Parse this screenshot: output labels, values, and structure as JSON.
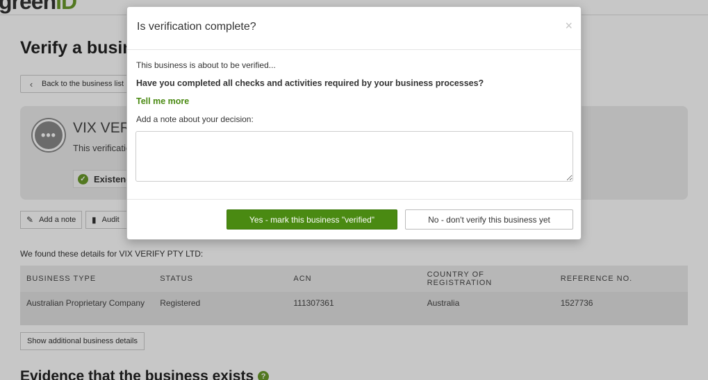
{
  "app": {
    "logo_text": "green",
    "logo_accent": "ID",
    "page_title": "Verify a business",
    "back_button_label": "Back to the business list"
  },
  "status_panel": {
    "icon": "ellipsis-icon",
    "company_name": "VIX VERIFY PTY LTD",
    "subtitle": "This verification is in progress",
    "existence_chip_label": "Existence"
  },
  "actions": {
    "add_note_label": "Add a note",
    "audit_label": "Audit"
  },
  "details": {
    "found_text": "We found these details for VIX VERIFY PTY LTD:",
    "columns": [
      "BUSINESS TYPE",
      "STATUS",
      "ACN",
      "COUNTRY OF REGISTRATION",
      "REFERENCE NO."
    ],
    "rows": [
      [
        "Australian Proprietary Company",
        "Registered",
        "111307361",
        "Australia",
        "1527736"
      ]
    ],
    "more_button_label": "Show additional business details"
  },
  "evidence": {
    "heading": "Evidence that the business exists"
  },
  "modal": {
    "title": "Is verification complete?",
    "close_glyph": "×",
    "line1": "This business is about to be verified...",
    "line2": "Have you completed all checks and activities required by your business processes?",
    "link_label": "Tell me more",
    "note_label": "Add a note about your decision:",
    "note_value": "",
    "yes_label": "Yes - mark this business \"verified\"",
    "no_label": "No - don't verify this business yet"
  },
  "colors": {
    "brand_green": "#4a8a12",
    "check_green": "#6a9a2a",
    "panel_gray": "#ececec"
  }
}
